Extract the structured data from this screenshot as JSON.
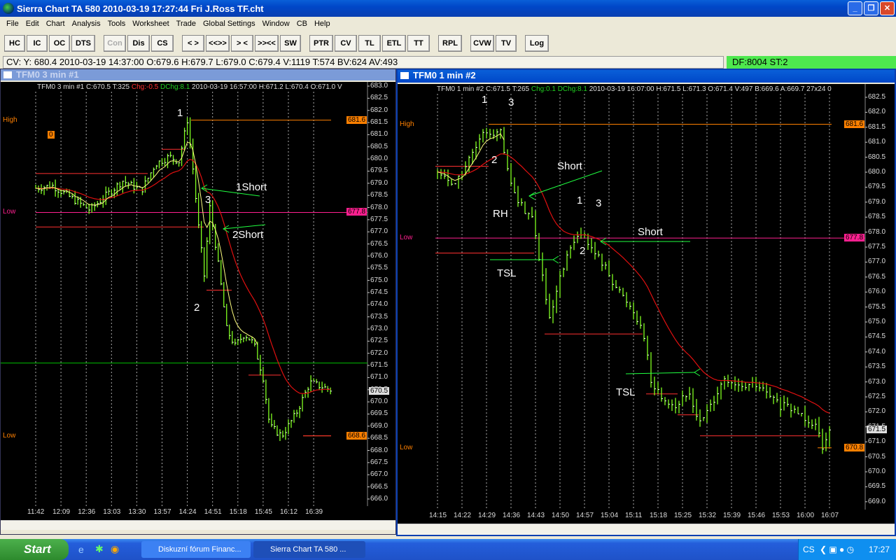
{
  "app": {
    "title": "Sierra Chart TA 580  2010-03-19  17:27:44  Fri   J.Ross TF.cht"
  },
  "menu": [
    "File",
    "Edit",
    "Chart",
    "Analysis",
    "Tools",
    "Worksheet",
    "Trade",
    "Global Settings",
    "Window",
    "CB",
    "Help"
  ],
  "toolbar": [
    [
      "HC",
      "IC",
      "OC",
      "DTS"
    ],
    [
      "Con",
      "Dis",
      "CS"
    ],
    [
      "< >",
      "<<>>",
      "> <",
      ">><<",
      "SW"
    ],
    [
      "PTR",
      "CV",
      "TL",
      "ETL",
      "TT"
    ],
    [
      "RPL"
    ],
    [
      "CVW",
      "TV"
    ],
    [
      "Log"
    ]
  ],
  "infobar": "CV: Y: 680.4  2010-03-19  14:37:00  O:679.6  H:679.7  L:679.0  C:679.4  V:1119  T:574  BV:624  AV:493",
  "status": "DF:8004   ST:2",
  "left": {
    "title": "TFM0  3 min   #1",
    "hdr_a": "TFM0  3 min   #1 C:670.5 T:325 ",
    "hdr_chg": "Chg:-0.5",
    "hdr_dchg": " DChg:8.1",
    "hdr_b": " 2010-03-19 16:57:00 H:671.2 L:670.4 O:671.0 V",
    "high_label": "High",
    "low_label": "Low",
    "low2_label": "Low",
    "zero_tag": "0",
    "tags": {
      "high": "681.6",
      "low": "677.8",
      "low2": "668.6",
      "last": "670.5"
    },
    "annotations": [
      "1",
      "3",
      "2",
      "1Short",
      "2Short"
    ]
  },
  "right": {
    "title": "TFM0  1 min   #2",
    "hdr_a": "TFM0  1 min   #2 C:671.5 T:265 ",
    "hdr_chg": "Chg:0.1",
    "hdr_dchg": " DChg:8.1",
    "hdr_b": " 2010-03-19 16:07:00 H:671.5 L:671.3 O:671.4 V:497 B:669.6 A:669.7 27x24 0",
    "high_label": "High",
    "low_label": "Low",
    "low2_label": "Low",
    "tags": {
      "high": "681.6",
      "low": "677.8",
      "low2": "670.8",
      "last": "671.5"
    },
    "annotations": [
      "1",
      "3",
      "2",
      "Short",
      "RH",
      "TSL",
      "1",
      "3",
      "2",
      "Short",
      "TSL"
    ]
  },
  "colors": {
    "bar": "#80ff20",
    "ma": "#e01010",
    "ma_fast": "#ffff80",
    "high": "#ff8000",
    "low": "#ff2090",
    "trail": "#ff3030",
    "green_line": "#00c000"
  },
  "chart_data": [
    {
      "type": "bar",
      "title": "TFM0 3 min #1",
      "ylim": [
        666.0,
        683.0
      ],
      "ystep": 0.5,
      "xticks": [
        "11:42",
        "12:09",
        "12:36",
        "13:03",
        "13:30",
        "13:57",
        "14:24",
        "14:51",
        "15:18",
        "15:45",
        "16:12",
        "16:39"
      ],
      "bar_minutes": 3,
      "start": "11:42",
      "end": "16:57",
      "path": [
        [
          "11:42",
          678.8
        ],
        [
          "12:00",
          678.9
        ],
        [
          "12:20",
          678.4
        ],
        [
          "12:40",
          677.9
        ],
        [
          "13:00",
          678.6
        ],
        [
          "13:15",
          679.1
        ],
        [
          "13:35",
          678.7
        ],
        [
          "13:50",
          679.8
        ],
        [
          "14:05",
          680.1
        ],
        [
          "14:15",
          679.9
        ],
        [
          "14:24",
          681.6
        ],
        [
          "14:30",
          679.6
        ],
        [
          "14:36",
          677.2
        ],
        [
          "14:42",
          675.2
        ],
        [
          "14:48",
          678.0
        ],
        [
          "14:54",
          676.5
        ],
        [
          "15:00",
          674.8
        ],
        [
          "15:06",
          673.0
        ],
        [
          "15:15",
          672.3
        ],
        [
          "15:25",
          672.8
        ],
        [
          "15:35",
          672.4
        ],
        [
          "15:45",
          671.0
        ],
        [
          "15:52",
          669.0
        ],
        [
          "16:05",
          668.6
        ],
        [
          "16:20",
          669.5
        ],
        [
          "16:35",
          670.8
        ],
        [
          "16:57",
          670.5
        ]
      ],
      "levels": {
        "high": 681.6,
        "low": 677.8,
        "low2": 668.6,
        "green": 671.6
      }
    },
    {
      "type": "bar",
      "title": "TFM0 1 min #2",
      "ylim": [
        669.0,
        682.5
      ],
      "ystep": 0.5,
      "xticks": [
        "14:15",
        "14:22",
        "14:29",
        "14:36",
        "14:43",
        "14:50",
        "14:57",
        "15:04",
        "15:11",
        "15:18",
        "15:25",
        "15:32",
        "15:39",
        "15:46",
        "15:53",
        "16:00",
        "16:07"
      ],
      "bar_minutes": 1,
      "start": "14:15",
      "end": "16:07",
      "path": [
        [
          "14:15",
          680.0
        ],
        [
          "14:20",
          679.6
        ],
        [
          "14:25",
          680.6
        ],
        [
          "14:29",
          681.4
        ],
        [
          "14:33",
          681.3
        ],
        [
          "14:35",
          680.0
        ],
        [
          "14:38",
          679.0
        ],
        [
          "14:42",
          678.5
        ],
        [
          "14:45",
          676.5
        ],
        [
          "14:47",
          675.0
        ],
        [
          "14:50",
          676.4
        ],
        [
          "14:53",
          677.5
        ],
        [
          "14:57",
          678.0
        ],
        [
          "14:59",
          677.4
        ],
        [
          "15:02",
          677.0
        ],
        [
          "15:07",
          676.0
        ],
        [
          "15:11",
          675.4
        ],
        [
          "15:14",
          674.6
        ],
        [
          "15:16",
          673.0
        ],
        [
          "15:19",
          672.5
        ],
        [
          "15:23",
          672.2
        ],
        [
          "15:27",
          672.6
        ],
        [
          "15:30",
          671.6
        ],
        [
          "15:33",
          672.2
        ],
        [
          "15:36",
          673.0
        ],
        [
          "15:41",
          672.8
        ],
        [
          "15:46",
          672.9
        ],
        [
          "15:53",
          672.2
        ],
        [
          "15:58",
          672.0
        ],
        [
          "16:03",
          671.6
        ],
        [
          "16:05",
          670.9
        ],
        [
          "16:07",
          671.5
        ]
      ],
      "levels": {
        "high": 681.6,
        "low": 677.8,
        "low2": 670.8
      }
    }
  ],
  "taskbar": {
    "start": "Start",
    "tasks": [
      "Diskuzní fórum Financ...",
      "Sierra Chart TA 580  ..."
    ],
    "lang": "CS",
    "clock": "17:27"
  }
}
